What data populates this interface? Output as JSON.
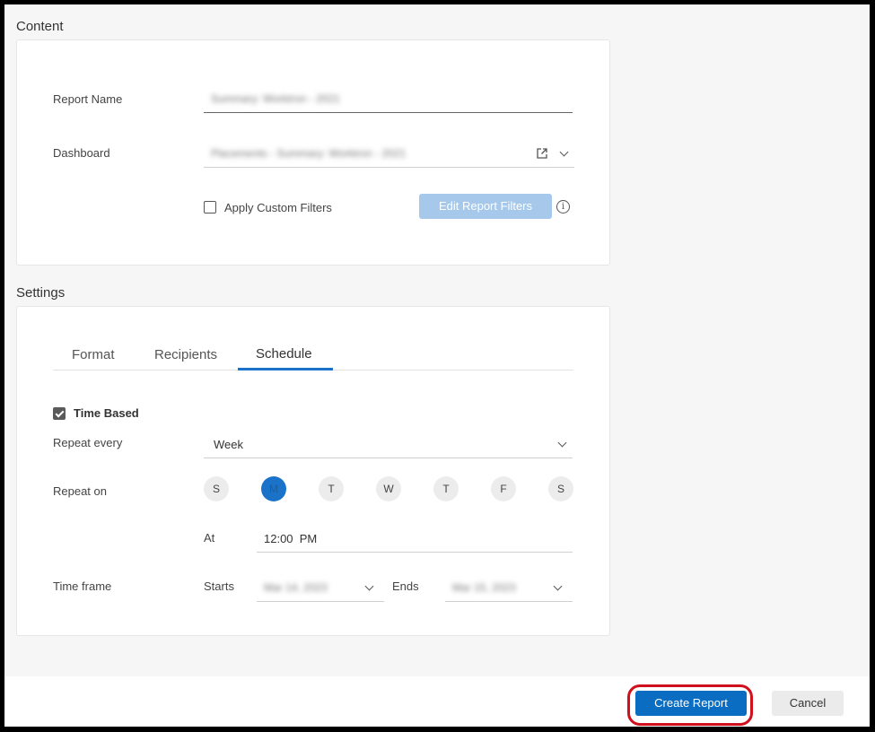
{
  "content": {
    "title": "Content",
    "report_name_label": "Report Name",
    "report_name_value": "Summary: Worktron - 2021",
    "dashboard_label": "Dashboard",
    "dashboard_value": "Placements - Summary: Worktron - 2021",
    "apply_custom_filters_label": "Apply Custom Filters",
    "apply_custom_filters_checked": false,
    "edit_filters_label": "Edit Report Filters",
    "info_glyph": "i"
  },
  "settings": {
    "title": "Settings",
    "tabs": [
      {
        "label": "Format"
      },
      {
        "label": "Recipients"
      },
      {
        "label": "Schedule"
      }
    ],
    "active_tab": "Schedule",
    "time_based_label": "Time Based",
    "time_based_checked": true,
    "repeat_every_label": "Repeat every",
    "repeat_every_value": "Week",
    "repeat_on_label": "Repeat on",
    "days": [
      "S",
      "M",
      "T",
      "W",
      "T",
      "F",
      "S"
    ],
    "active_day_index": 1,
    "at_label": "At",
    "at_value": "12:00  PM",
    "time_frame_label": "Time frame",
    "starts_label": "Starts",
    "starts_value": "Mar 14, 2023",
    "ends_label": "Ends",
    "ends_value": "Mar 15, 2023"
  },
  "footer": {
    "create_label": "Create Report",
    "cancel_label": "Cancel"
  },
  "colors": {
    "primary": "#0a6dc2",
    "disabled_primary": "#a6c8ea",
    "highlight": "#d0101c",
    "active_tab_underline": "#1a73c8"
  },
  "icons": [
    "external-link-icon",
    "chevron-down-icon",
    "info-icon",
    "checkbox-icon"
  ]
}
